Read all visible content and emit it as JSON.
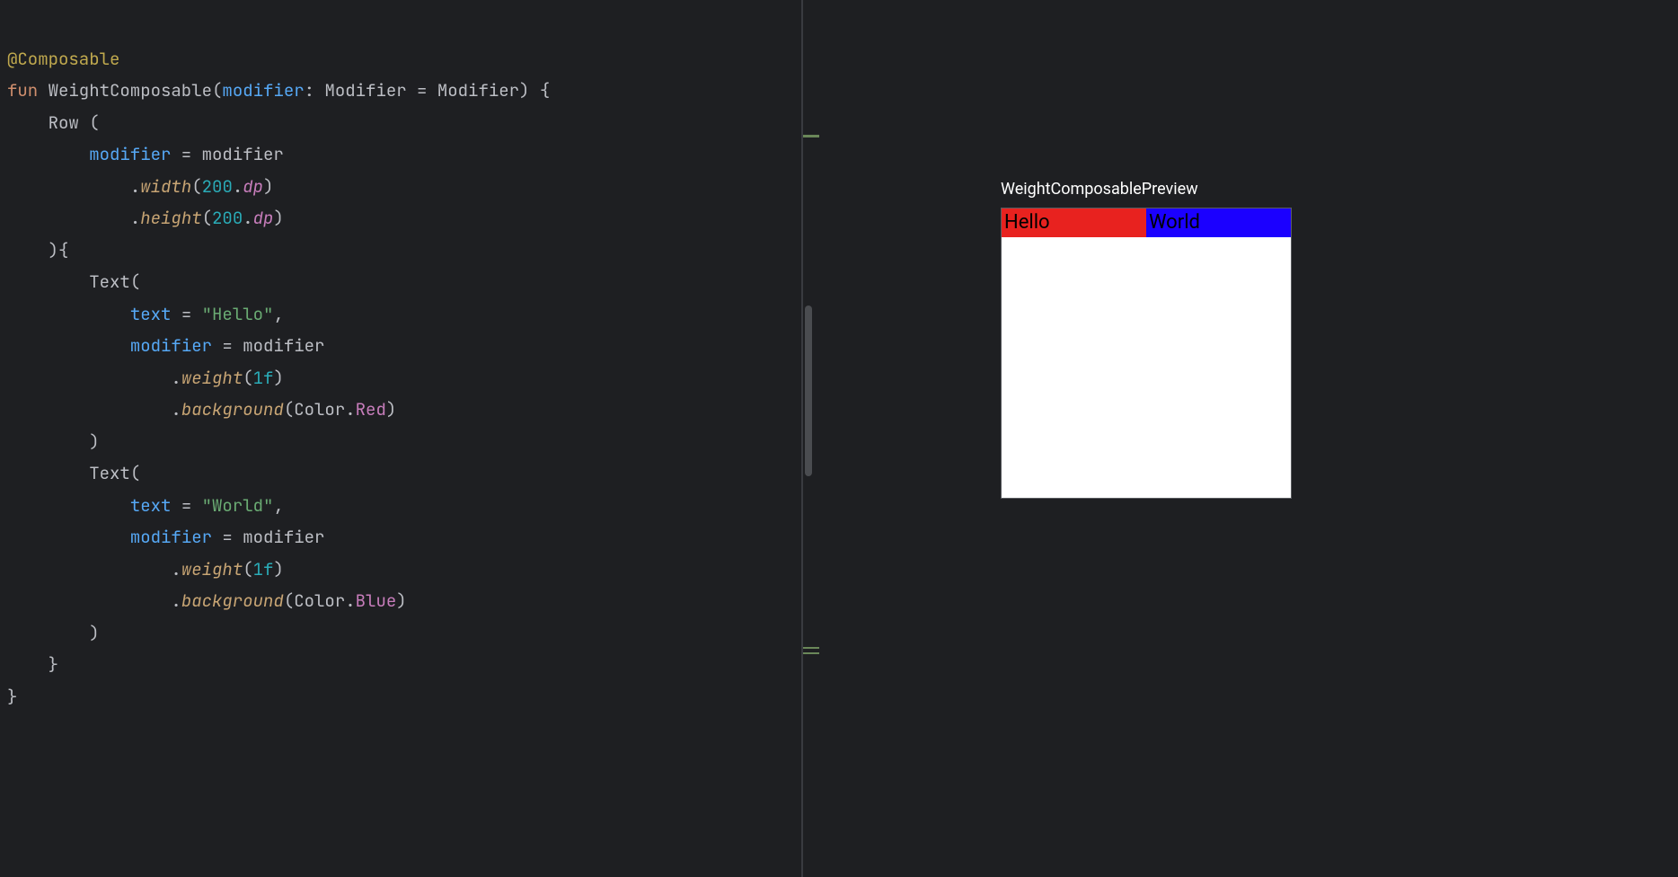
{
  "code": {
    "l1": "@Composable",
    "l2_fun": "fun ",
    "l2_name": "WeightComposable",
    "l2_open": "(",
    "l2_param": "modifier",
    "l2_colon": ": ",
    "l2_type": "Modifier",
    "l2_eq": " = ",
    "l2_def": "Modifier",
    "l2_close": ") {",
    "l3_row": "Row ",
    "l3_open": "(",
    "l4_mod": "modifier",
    "l4_eq": " = modifier",
    "l5_dot": ".",
    "l5_width": "width",
    "l5_open": "(",
    "l5_200": "200",
    "l5_dotdp": ".",
    "l5_dp": "dp",
    "l5_close": ")",
    "l6_height": "height",
    "l6_200": "200",
    "l7_close": "){",
    "l8_text": "Text",
    "l8_open": "(",
    "l9_textp": "text",
    "l9_eq": " = ",
    "l9_str": "\"Hello\"",
    "l9_comma": ",",
    "l10_mod": "modifier",
    "l10_eq": " = modifier",
    "l11_weight": "weight",
    "l11_1f": "1f",
    "l12_bg": "background",
    "l12_color": "Color",
    "l12_red": "Red",
    "l13_close": ")",
    "l15_str": "\"World\"",
    "l18_blue": "Blue",
    "l20_brace": "}",
    "l21_brace": "}"
  },
  "preview": {
    "title": "WeightComposablePreview",
    "text1": "Hello",
    "text2": "World"
  }
}
